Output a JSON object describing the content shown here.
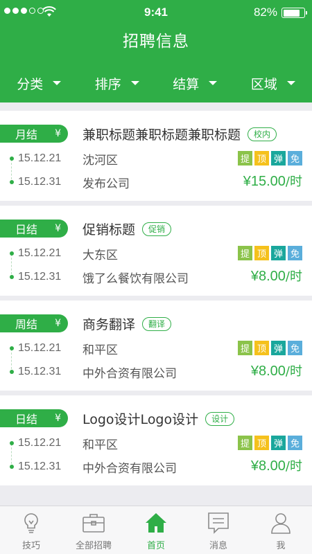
{
  "status_bar": {
    "time": "9:41",
    "battery_percent": "82%",
    "battery_level": 0.82,
    "signal_bars_filled": 3,
    "signal_bars_total": 5
  },
  "header": {
    "title": "招聘信息",
    "background_color": "#2fae47"
  },
  "filters": [
    {
      "label": "分类"
    },
    {
      "label": "排序"
    },
    {
      "label": "结算"
    },
    {
      "label": "区域"
    }
  ],
  "jobs": [
    {
      "pay_cycle": "月结",
      "currency_symbol": "¥",
      "title": "兼职标题兼职标题兼职标题",
      "tag": "校内",
      "start_date": "15.12.21",
      "end_date": "15.12.31",
      "district": "沈河区",
      "company": "发布公司",
      "flags": [
        "提",
        "顶",
        "弹",
        "免"
      ],
      "price": "¥15.00",
      "price_unit": "/时"
    },
    {
      "pay_cycle": "日结",
      "currency_symbol": "¥",
      "title": "促销标题",
      "tag": "促销",
      "start_date": "15.12.21",
      "end_date": "15.12.31",
      "district": "大东区",
      "company": "饿了么餐饮有限公司",
      "flags": [
        "提",
        "顶",
        "弹",
        "免"
      ],
      "price": "¥8.00",
      "price_unit": "/时"
    },
    {
      "pay_cycle": "周结",
      "currency_symbol": "¥",
      "title": "商务翻译",
      "tag": "翻译",
      "start_date": "15.12.21",
      "end_date": "15.12.31",
      "district": "和平区",
      "company": "中外合资有限公司",
      "flags": [
        "提",
        "顶",
        "弹",
        "免"
      ],
      "price": "¥8.00",
      "price_unit": "/时"
    },
    {
      "pay_cycle": "日结",
      "currency_symbol": "¥",
      "title": "Logo设计Logo设计",
      "tag": "设计",
      "start_date": "15.12.21",
      "end_date": "15.12.31",
      "district": "和平区",
      "company": "中外合资有限公司",
      "flags": [
        "提",
        "顶",
        "弹",
        "免"
      ],
      "price": "¥8.00",
      "price_unit": "/时"
    }
  ],
  "tabbar": [
    {
      "label": "技巧",
      "icon": "lightbulb-icon"
    },
    {
      "label": "全部招聘",
      "icon": "briefcase-icon"
    },
    {
      "label": "首页",
      "icon": "home-icon",
      "active": true
    },
    {
      "label": "消息",
      "icon": "message-icon"
    },
    {
      "label": "我",
      "icon": "user-icon"
    }
  ],
  "colors": {
    "accent": "#2fae47",
    "flag_ti": "#8bc34a",
    "flag_ding": "#f5c11c",
    "flag_tan": "#1aa79c",
    "flag_mian": "#5aaedb"
  }
}
